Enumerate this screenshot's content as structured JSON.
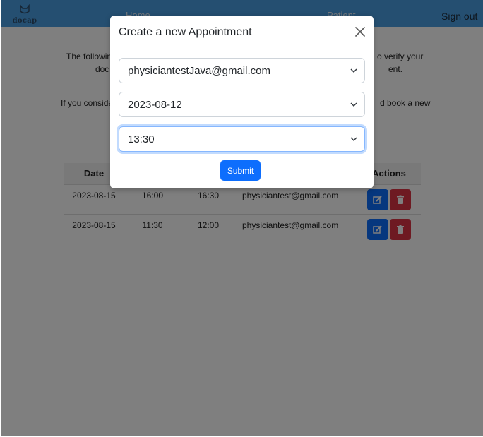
{
  "navbar": {
    "logo_text": "docap",
    "home_label": "Home",
    "patient_label": "Patient",
    "signout_label": "Sign out"
  },
  "intro": {
    "line1_left": "The followin",
    "line1_right": "o verify your",
    "line2_left": "doc",
    "line2_right": "ent.",
    "line3_left": "If you conside",
    "line3_right": "d book a new"
  },
  "table": {
    "columns": [
      "Date",
      "",
      "",
      "",
      "Actions"
    ],
    "rows": [
      {
        "date": "2023-08-15",
        "start": "16:00",
        "end": "16:30",
        "email": "physiciantest@gmail.com"
      },
      {
        "date": "2023-08-15",
        "start": "11:30",
        "end": "12:00",
        "email": "physiciantest@gmail.com"
      }
    ]
  },
  "modal": {
    "title": "Create a new Appointment",
    "physician_value": "physiciantestJava@gmail.com",
    "date_value": "2023-08-12",
    "time_value": "13:30",
    "submit_label": "Submit"
  },
  "icons": {
    "close": "close-icon",
    "chevron": "chevron-down-icon",
    "edit": "edit-icon",
    "delete": "trash-icon",
    "logo": "cat-logo-icon"
  },
  "colors": {
    "navbar": "#4a9fe2",
    "primary": "#0d6efd",
    "danger": "#dc3545",
    "focus_ring": "#86b7fe"
  }
}
